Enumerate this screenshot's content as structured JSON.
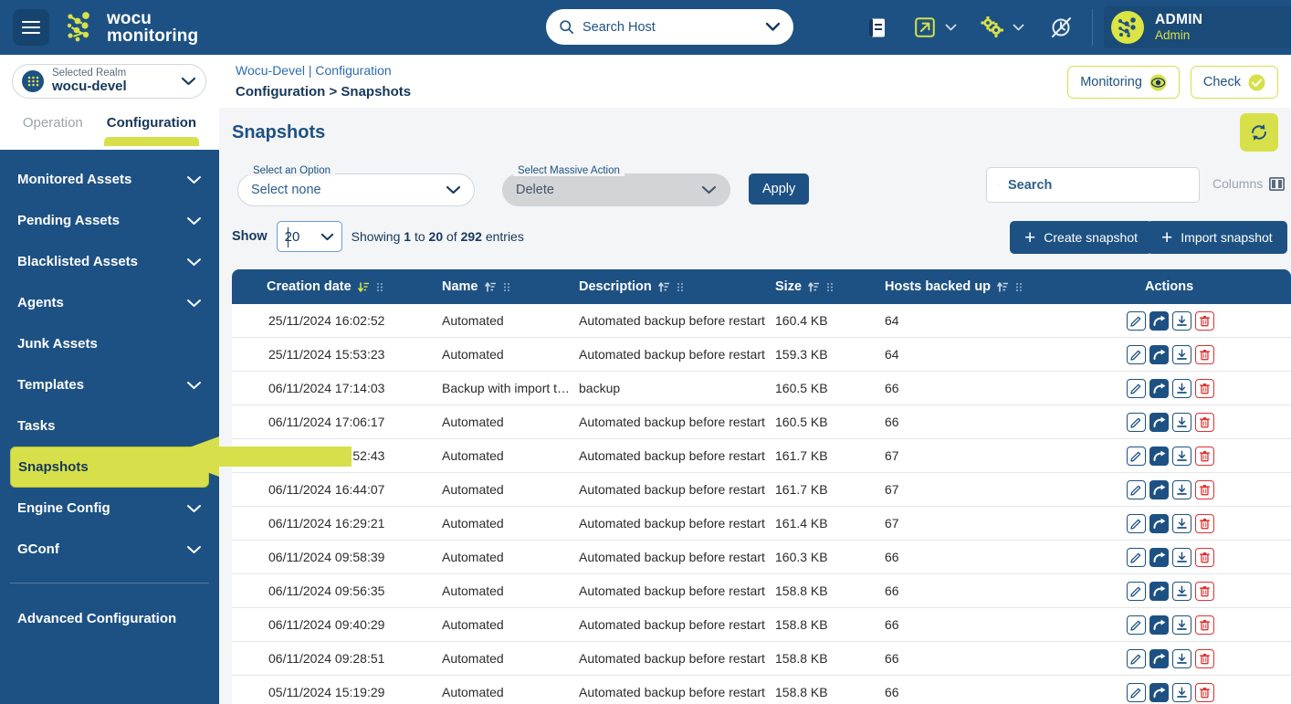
{
  "header": {
    "menu_icon": "hamburger-icon",
    "brand_line1": "wocu",
    "brand_line2": "monitoring",
    "search_placeholder": "Search Host",
    "search_value": "",
    "icons": [
      "document-icon",
      "external-link-icon",
      "gears-icon",
      "mute-notifications-icon"
    ],
    "user_name": "ADMIN",
    "user_role": "Admin"
  },
  "realm": {
    "label": "Selected Realm",
    "value": "wocu-devel"
  },
  "breadcrumb": {
    "line1": "Wocu-Devel | Configuration",
    "line2": "Configuration > Snapshots"
  },
  "top_buttons": [
    {
      "label": "Monitoring",
      "icon": "eye-icon"
    },
    {
      "label": "Check",
      "icon": "check-circle-icon"
    }
  ],
  "tabs": [
    {
      "label": "Operation",
      "active": false
    },
    {
      "label": "Configuration",
      "active": true
    }
  ],
  "sidebar": {
    "items": [
      {
        "label": "Monitored Assets",
        "expandable": true,
        "active": false
      },
      {
        "label": "Pending Assets",
        "expandable": true,
        "active": false
      },
      {
        "label": "Blacklisted Assets",
        "expandable": true,
        "active": false
      },
      {
        "label": "Agents",
        "expandable": true,
        "active": false
      },
      {
        "label": "Junk Assets",
        "expandable": false,
        "active": false
      },
      {
        "label": "Templates",
        "expandable": true,
        "active": false
      },
      {
        "label": "Tasks",
        "expandable": false,
        "active": false
      },
      {
        "label": "Snapshots",
        "expandable": false,
        "active": true
      },
      {
        "label": "Engine Config",
        "expandable": true,
        "active": false
      },
      {
        "label": "GConf",
        "expandable": true,
        "active": false
      }
    ],
    "footer_item": {
      "label": "Advanced Configuration"
    }
  },
  "main": {
    "title": "Snapshots",
    "refresh_icon": "refresh-icon",
    "option_select": {
      "label": "Select an Option",
      "value": "Select none"
    },
    "massive_action_select": {
      "label": "Select Massive Action",
      "value": "Delete"
    },
    "apply_label": "Apply",
    "show_label": "Show",
    "show_value": "20",
    "entries_text_prefix": "Showing ",
    "entries_from": "1",
    "entries_mid1": " to ",
    "entries_to": "20",
    "entries_mid2": " of ",
    "entries_total": "292",
    "entries_suffix": " entries",
    "search_placeholder": "Search",
    "search_value": "",
    "columns_label": "Columns",
    "create_label": "Create snapshot",
    "import_label": "Import snapshot"
  },
  "table": {
    "columns": [
      {
        "label": "Creation date",
        "sort": "desc",
        "resizable": true
      },
      {
        "label": "Name",
        "sort": "asc",
        "resizable": true
      },
      {
        "label": "Description",
        "sort": "asc",
        "resizable": true
      },
      {
        "label": "Size",
        "sort": "asc",
        "resizable": true
      },
      {
        "label": "Hosts backed up",
        "sort": "asc",
        "resizable": true
      },
      {
        "label": "Actions",
        "sort": "none",
        "resizable": false
      }
    ],
    "action_icons": [
      "edit-icon",
      "restore-icon",
      "download-icon",
      "delete-icon"
    ],
    "rows": [
      {
        "date": "25/11/2024 16:02:52",
        "name": "Automated",
        "description": "Automated backup before restart",
        "size": "160.4 KB",
        "hosts": "64"
      },
      {
        "date": "25/11/2024 15:53:23",
        "name": "Automated",
        "description": "Automated backup before restart",
        "size": "159.3 KB",
        "hosts": "64"
      },
      {
        "date": "06/11/2024 17:14:03",
        "name": "Backup with import t…",
        "description": "backup",
        "size": "160.5 KB",
        "hosts": "66"
      },
      {
        "date": "06/11/2024 17:06:17",
        "name": "Automated",
        "description": "Automated backup before restart",
        "size": "160.5 KB",
        "hosts": "66"
      },
      {
        "date": "06/11/2024 16:52:43",
        "name": "Automated",
        "description": "Automated backup before restart",
        "size": "161.7 KB",
        "hosts": "67"
      },
      {
        "date": "06/11/2024 16:44:07",
        "name": "Automated",
        "description": "Automated backup before restart",
        "size": "161.7 KB",
        "hosts": "67"
      },
      {
        "date": "06/11/2024 16:29:21",
        "name": "Automated",
        "description": "Automated backup before restart",
        "size": "161.4 KB",
        "hosts": "67"
      },
      {
        "date": "06/11/2024 09:58:39",
        "name": "Automated",
        "description": "Automated backup before restart",
        "size": "160.3 KB",
        "hosts": "66"
      },
      {
        "date": "06/11/2024 09:56:35",
        "name": "Automated",
        "description": "Automated backup before restart",
        "size": "158.8 KB",
        "hosts": "66"
      },
      {
        "date": "06/11/2024 09:40:29",
        "name": "Automated",
        "description": "Automated backup before restart",
        "size": "158.8 KB",
        "hosts": "66"
      },
      {
        "date": "06/11/2024 09:28:51",
        "name": "Automated",
        "description": "Automated backup before restart",
        "size": "158.8 KB",
        "hosts": "66"
      },
      {
        "date": "05/11/2024 15:19:29",
        "name": "Automated",
        "description": "Automated backup before restart",
        "size": "158.8 KB",
        "hosts": "66"
      }
    ]
  },
  "annotation": {
    "type": "arrow-left",
    "points_to": "Snapshots",
    "color": "#d7e04a"
  },
  "colors": {
    "brand_blue": "#1d5183",
    "accent_lime": "#d7e04a",
    "page_bg": "#f4f5f7",
    "danger_red": "#e03131"
  }
}
